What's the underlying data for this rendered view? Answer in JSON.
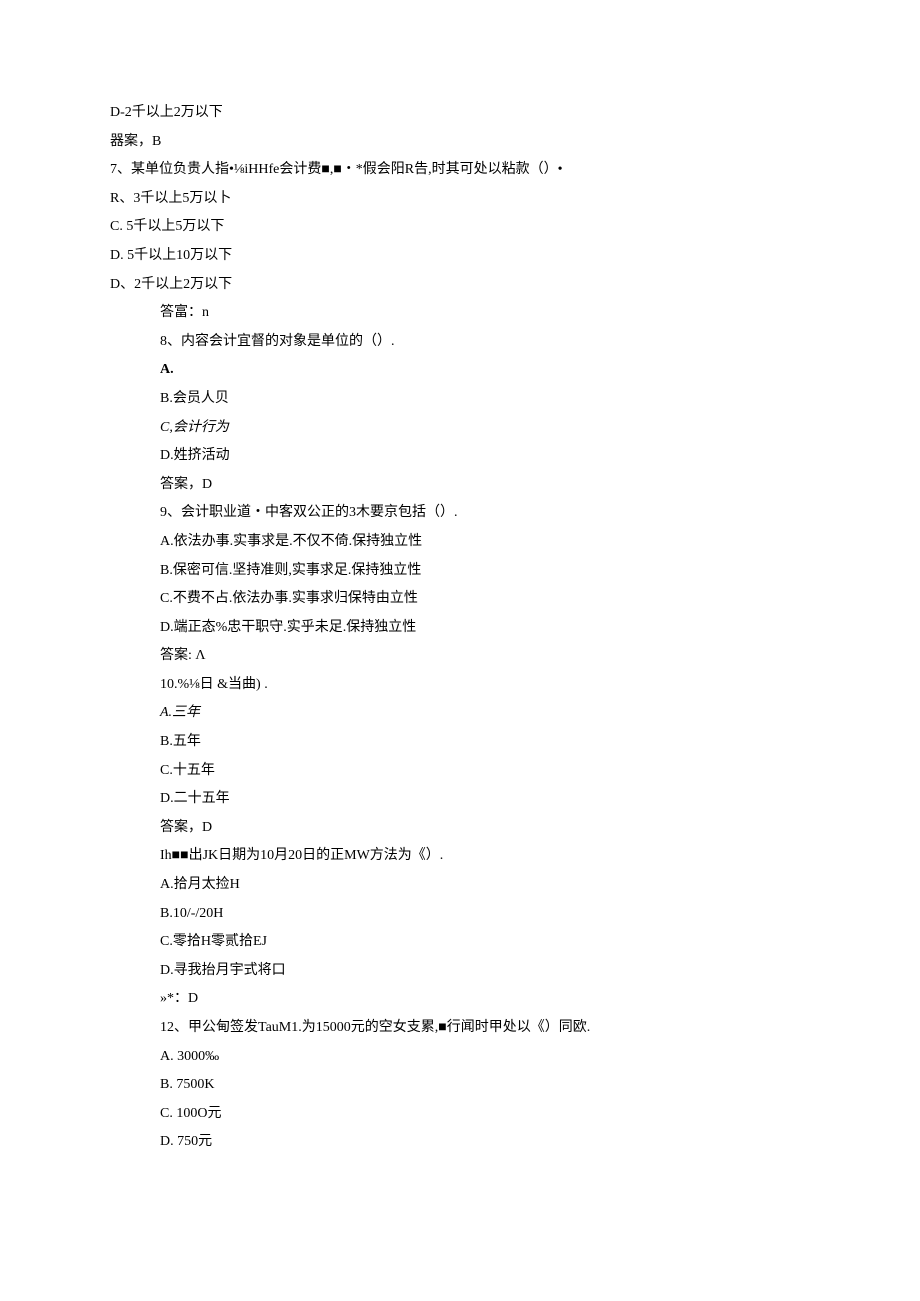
{
  "lines": [
    {
      "text": "D-2千以上2万以下",
      "indent": 0,
      "bold": false
    },
    {
      "text": "器案，B",
      "indent": 0,
      "bold": false
    },
    {
      "text": "7、某单位负贵人指•⅛iHHfe会计费■,■・*假会阳R告,时其可处以粘款（）•",
      "indent": 0,
      "bold": false
    },
    {
      "text": "R、3千以上5万以卜",
      "indent": 0,
      "bold": false
    },
    {
      "text": "C.   5千以上5万以下",
      "indent": 0,
      "bold": false
    },
    {
      "text": "D.   5千以上10万以下",
      "indent": 0,
      "bold": false
    },
    {
      "text": "D、2千以上2万以下",
      "indent": 0,
      "bold": false
    },
    {
      "text": "答富：n",
      "indent": 1,
      "bold": false
    },
    {
      "text": "8、内容会计宜督的对象是单位的（）.",
      "indent": 1,
      "bold": false
    },
    {
      "text": "A.",
      "indent": 1,
      "bold": true
    },
    {
      "text": "B.会员人贝",
      "indent": 1,
      "bold": false
    },
    {
      "text": "C,会计行为",
      "indent": 1,
      "bold": false,
      "italic": true
    },
    {
      "text": "D.姓挤活动",
      "indent": 1,
      "bold": false
    },
    {
      "text": "答案，D",
      "indent": 1,
      "bold": false
    },
    {
      "text": "9、会计职业道・中客双公正的3木要京包括（）.",
      "indent": 1,
      "bold": false
    },
    {
      "text": "A.依法办事.实事求是.不仅不倚.保持独立性",
      "indent": 1,
      "bold": false
    },
    {
      "text": "B.保密可信.坚持准则,实事求足.保持独立性",
      "indent": 1,
      "bold": false
    },
    {
      "text": "C.不费不占.依法办事.实事求归保特由立性",
      "indent": 1,
      "bold": false
    },
    {
      "text": "D.端正态%忠干职守.实乎未足.保持独立性",
      "indent": 1,
      "bold": false
    },
    {
      "text": "答案: Λ",
      "indent": 1,
      "bold": false
    },
    {
      "text": "10.%⅛日        &当曲) .",
      "indent": 1,
      "bold": false
    },
    {
      "text": "A.三年",
      "indent": 1,
      "bold": false,
      "italic": true
    },
    {
      "text": "B.五年",
      "indent": 1,
      "bold": false
    },
    {
      "text": "C.十五年",
      "indent": 1,
      "bold": false
    },
    {
      "text": "D.二十五年",
      "indent": 1,
      "bold": false
    },
    {
      "text": "答案，D",
      "indent": 1,
      "bold": false
    },
    {
      "text": "Ih■■出JK日期为10月20日的正MW方法为《）.",
      "indent": 1,
      "bold": false
    },
    {
      "text": "A.拾月太捡H",
      "indent": 1,
      "bold": false
    },
    {
      "text": "B.10/-/20H",
      "indent": 1,
      "bold": false
    },
    {
      "text": "C.零拾H零贰拾EJ",
      "indent": 1,
      "bold": false
    },
    {
      "text": "D.寻我抬月宇式将口",
      "indent": 1,
      "bold": false
    },
    {
      "text": "»*：D",
      "indent": 1,
      "bold": false
    },
    {
      "text": "12、甲公甸签发TauM1.为15000元的空女支累,■行闻时甲处以《）同欧.",
      "indent": 1,
      "bold": false
    },
    {
      "text": "A.    3000‰",
      "indent": 1,
      "bold": false
    },
    {
      "text": "B.    7500K",
      "indent": 1,
      "bold": false
    },
    {
      "text": "C.    100O元",
      "indent": 1,
      "bold": false
    },
    {
      "text": "D.    750元",
      "indent": 1,
      "bold": false
    }
  ]
}
